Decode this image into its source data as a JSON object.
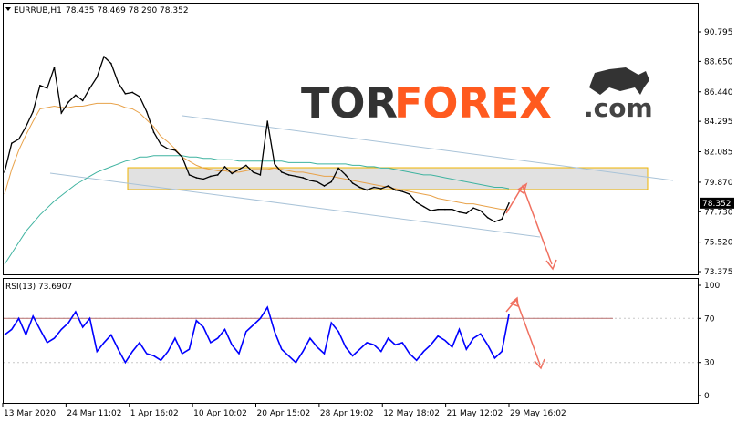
{
  "header": {
    "symbol": "EURRUB,H1",
    "ohlc": "78.435 78.469 78.290 78.352"
  },
  "rsi_header": "RSI(13) 73.6907",
  "watermark": {
    "part1": "TOR",
    "part2": "FOREX",
    "part3": ".com"
  },
  "colors": {
    "price": "#000000",
    "bull_candle": "#000000",
    "ma_fast": "#e8a24a",
    "ma_slow": "#3fb3a0",
    "channel": "#a9c3d8",
    "zone_fill": "#d7d7d7",
    "zone_border": "#f0b400",
    "arrow": "#f07060",
    "rsi_line": "#0000ff",
    "rsi_level": "#c08080",
    "current_price_box": "#000000",
    "brand_dark": "#333333",
    "brand_red": "#ff5a1f"
  },
  "chart_data": [
    {
      "type": "line",
      "title": "EURRUB,H1",
      "y_ticks": [
        "90.795",
        "88.650",
        "86.440",
        "84.295",
        "82.085",
        "79.870",
        "77.730",
        "75.520",
        "73.375"
      ],
      "ylim": [
        73.375,
        90.795
      ],
      "current_price": "78.352",
      "x_labels": [
        "13 Mar 2020",
        "24 Mar 11:02",
        "1 Apr 16:02",
        "10 Apr 10:02",
        "20 Apr 15:02",
        "28 Apr 19:02",
        "12 May 18:02",
        "21 May 12:02",
        "29 May 16:02"
      ],
      "series": [
        {
          "values": [
            80.6,
            82.7,
            83.0,
            83.9,
            85.0,
            86.9,
            86.7,
            88.2,
            84.9,
            85.7,
            86.2,
            85.8,
            86.7,
            87.5,
            89.0,
            88.5,
            87.1,
            86.3,
            86.4,
            86.1,
            85.0,
            83.5,
            82.6,
            82.3,
            82.2,
            81.7,
            80.4,
            80.2,
            80.1,
            80.3,
            80.4,
            81.0,
            80.5,
            80.8,
            81.1,
            80.6,
            80.4,
            84.3,
            81.2,
            80.6,
            80.4,
            80.3,
            80.2,
            80.0,
            79.9,
            79.6,
            79.9,
            80.9,
            80.4,
            79.8,
            79.5,
            79.3,
            79.5,
            79.4,
            79.6,
            79.3,
            79.2,
            79.0,
            78.4,
            78.1,
            77.8,
            77.9,
            77.9,
            77.9,
            77.7,
            77.6,
            78.0,
            77.8,
            77.3,
            77.0,
            77.2,
            78.352
          ]
        },
        {
          "name": "",
          "values": [
            79.0,
            80.8,
            82.2,
            83.3,
            84.3,
            85.2,
            85.3,
            85.4,
            85.3,
            85.3,
            85.4,
            85.4,
            85.5,
            85.6,
            85.6,
            85.6,
            85.5,
            85.3,
            85.2,
            84.9,
            84.4,
            83.9,
            83.2,
            82.8,
            82.3,
            81.7,
            81.4,
            81.1,
            80.9,
            80.8,
            80.7,
            80.7,
            80.6,
            80.6,
            80.7,
            80.8,
            80.8,
            80.8,
            80.9,
            80.8,
            80.7,
            80.6,
            80.6,
            80.5,
            80.4,
            80.3,
            80.3,
            80.2,
            80.1,
            80.0,
            79.9,
            79.8,
            79.7,
            79.6,
            79.5,
            79.4,
            79.3,
            79.2,
            79.1,
            79.0,
            78.9,
            78.7,
            78.6,
            78.5,
            78.4,
            78.3,
            78.3,
            78.2,
            78.1,
            78.0,
            77.9,
            77.9
          ]
        },
        {
          "name": "",
          "values": [
            73.9,
            74.7,
            75.5,
            76.3,
            76.9,
            77.5,
            78.0,
            78.5,
            78.9,
            79.3,
            79.7,
            80.0,
            80.3,
            80.6,
            80.8,
            81.0,
            81.2,
            81.4,
            81.5,
            81.7,
            81.7,
            81.8,
            81.8,
            81.8,
            81.8,
            81.8,
            81.7,
            81.7,
            81.6,
            81.6,
            81.5,
            81.5,
            81.5,
            81.4,
            81.4,
            81.4,
            81.4,
            81.4,
            81.4,
            81.4,
            81.3,
            81.3,
            81.3,
            81.3,
            81.2,
            81.2,
            81.2,
            81.2,
            81.2,
            81.1,
            81.1,
            81.0,
            81.0,
            80.9,
            80.9,
            80.8,
            80.7,
            80.6,
            80.5,
            80.4,
            80.4,
            80.3,
            80.2,
            80.1,
            80.0,
            79.9,
            79.8,
            79.7,
            79.6,
            79.5,
            79.5,
            79.4
          ]
        }
      ]
    },
    {
      "type": "line",
      "title": "RSI(13) 73.6907",
      "y_ticks": [
        "100",
        "70",
        "30",
        "0"
      ],
      "ylim": [
        0,
        100
      ],
      "levels": [
        70,
        30
      ],
      "series": [
        {
          "values": [
            55,
            60,
            70,
            55,
            72,
            60,
            48,
            52,
            60,
            66,
            76,
            62,
            70,
            40,
            48,
            55,
            42,
            30,
            40,
            48,
            38,
            36,
            32,
            40,
            52,
            38,
            42,
            68,
            62,
            48,
            52,
            60,
            46,
            38,
            58,
            64,
            70,
            80,
            58,
            42,
            36,
            30,
            40,
            52,
            44,
            38,
            66,
            58,
            44,
            36,
            42,
            48,
            46,
            40,
            52,
            46,
            48,
            38,
            32,
            40,
            46,
            54,
            50,
            44,
            60,
            42,
            52,
            56,
            46,
            34,
            40,
            73.69
          ]
        }
      ]
    }
  ]
}
